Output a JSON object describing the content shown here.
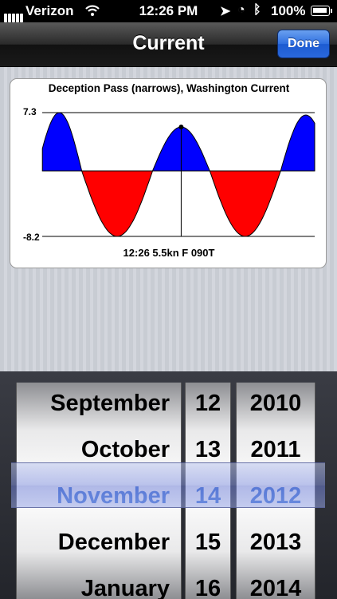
{
  "status_bar": {
    "carrier": "Verizon",
    "time": "12:26 PM",
    "battery": "100%"
  },
  "nav": {
    "title": "Current",
    "done_label": "Done"
  },
  "chart_data": {
    "type": "area",
    "title": "Deception Pass (narrows), Washington Current",
    "ylim": [
      -8.2,
      7.3
    ],
    "ytick_labels": [
      "7.3",
      "-8.2"
    ],
    "caption": "12:26  5.5kn F 090T",
    "current_marker_value": 5.5,
    "colors": {
      "flood": "#0000ff",
      "ebb": "#ff0000"
    },
    "series": [
      {
        "segment": "flood",
        "peak": 7.3
      },
      {
        "segment": "ebb",
        "peak": -8.2
      },
      {
        "segment": "flood",
        "peak": 5.5
      },
      {
        "segment": "ebb",
        "peak": -8.2
      },
      {
        "segment": "flood",
        "peak": 7.0
      }
    ]
  },
  "picker": {
    "months": [
      "September",
      "October",
      "November",
      "December",
      "January"
    ],
    "days": [
      "12",
      "13",
      "14",
      "15",
      "16"
    ],
    "years": [
      "2010",
      "2011",
      "2012",
      "2013",
      "2014"
    ],
    "selected": {
      "month": "November",
      "day": "14",
      "year": "2012"
    }
  }
}
